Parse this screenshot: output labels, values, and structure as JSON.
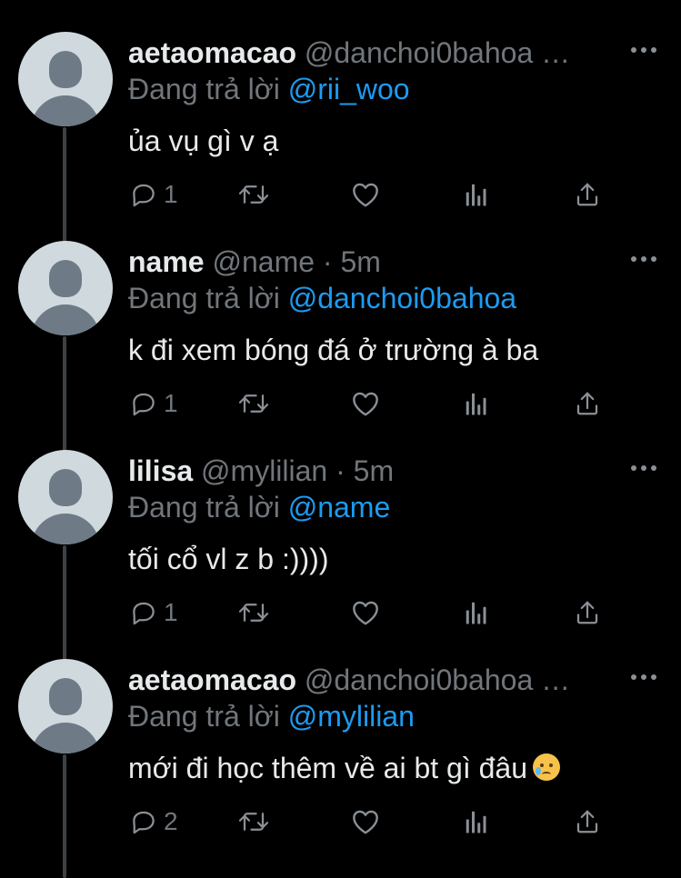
{
  "reply_prefix": "Đang trả lời",
  "tweets": [
    {
      "name": "aetaomacao",
      "handle": "@danchoi0bahoa",
      "separator": "…",
      "time": "",
      "reply_to": "@rii_woo",
      "text": "ủa vụ gì v ạ",
      "reply_count": "1",
      "has_emoji": false
    },
    {
      "name": "name",
      "handle": "@name",
      "separator": "·",
      "time": "5m",
      "reply_to": "@danchoi0bahoa",
      "text": "k đi xem bóng đá ở trường à ba",
      "reply_count": "1",
      "has_emoji": false
    },
    {
      "name": "lilisa",
      "handle": "@mylilian",
      "separator": "·",
      "time": "5m",
      "reply_to": "@name",
      "text": "tối cổ vl z b :))))",
      "reply_count": "1",
      "has_emoji": false
    },
    {
      "name": "aetaomacao",
      "handle": "@danchoi0bahoa",
      "separator": "…",
      "time": "",
      "reply_to": "@mylilian",
      "text": "mới đi học thêm về ai bt gì đâu",
      "reply_count": "2",
      "has_emoji": true,
      "emoji_name": "crying-face-emoji"
    }
  ],
  "icons": {
    "reply": "reply-icon",
    "retweet": "retweet-icon",
    "like": "heart-icon",
    "analytics": "analytics-icon",
    "share": "share-icon",
    "more": "more-icon",
    "avatar": "default-avatar"
  },
  "colors": {
    "background": "#000000",
    "text_primary": "#e7e9ea",
    "text_secondary": "#71767b",
    "mention": "#1d9bf0",
    "thread_line": "#3e4144",
    "avatar_bg": "#cfd9de",
    "avatar_fg": "#6e7b86"
  }
}
